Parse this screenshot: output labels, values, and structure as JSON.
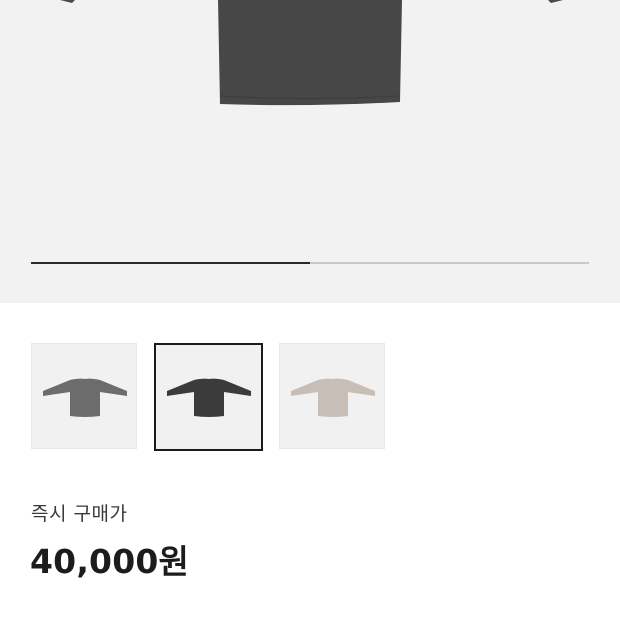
{
  "gallery": {
    "progress": 0.5,
    "thumbnails": [
      {
        "color_name": "gray",
        "color": "#6c6c6c",
        "selected": false
      },
      {
        "color_name": "charcoal",
        "color": "#3b3b3b",
        "selected": true
      },
      {
        "color_name": "beige",
        "color": "#c7bfb7",
        "selected": false
      }
    ],
    "hero_color": "#474747"
  },
  "purchase": {
    "label": "즉시 구매가",
    "price": "40,000원"
  },
  "colors": {
    "hero_background": "#f2f2f2",
    "progress_fill": "#2a2a2a",
    "progress_track": "#c9c9c9",
    "selected_border": "#1b1b1b"
  }
}
